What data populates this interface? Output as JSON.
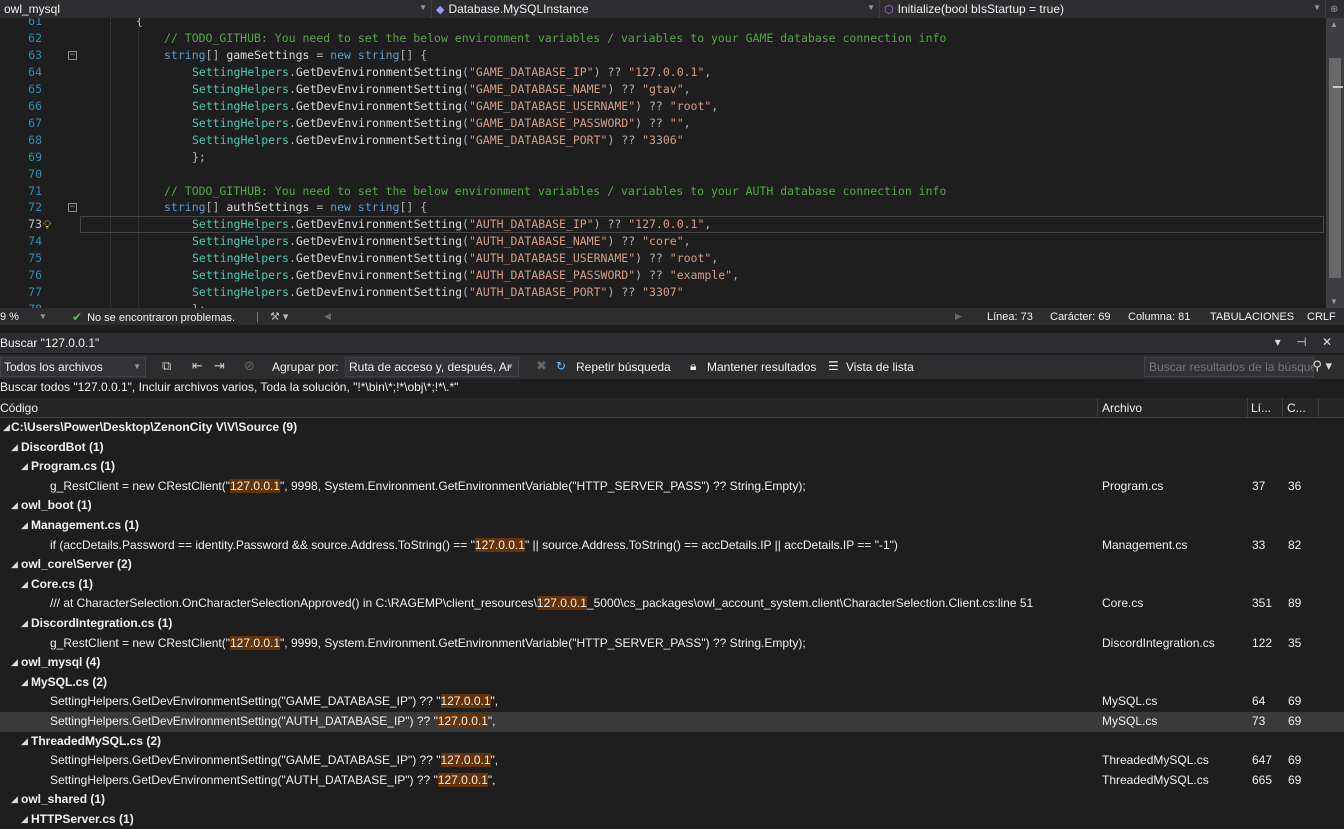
{
  "nav": {
    "project": "owl_mysql",
    "class": "Database.MySQLInstance",
    "method": "Initialize(bool bIsStartup = true)"
  },
  "editor": {
    "lines": [
      {
        "n": "61",
        "text": "{"
      },
      {
        "n": "62",
        "text": "// TODO_GITHUB: You need to set the below environment variables / variables to your GAME database connection info"
      },
      {
        "n": "63",
        "text": "string[] gameSettings = new string[] {"
      },
      {
        "n": "64",
        "text": "SettingHelpers.GetDevEnvironmentSetting(\"GAME_DATABASE_IP\") ?? \"127.0.0.1\","
      },
      {
        "n": "65",
        "text": "SettingHelpers.GetDevEnvironmentSetting(\"GAME_DATABASE_NAME\") ?? \"gtav\","
      },
      {
        "n": "66",
        "text": "SettingHelpers.GetDevEnvironmentSetting(\"GAME_DATABASE_USERNAME\") ?? \"root\","
      },
      {
        "n": "67",
        "text": "SettingHelpers.GetDevEnvironmentSetting(\"GAME_DATABASE_PASSWORD\") ?? \"\","
      },
      {
        "n": "68",
        "text": "SettingHelpers.GetDevEnvironmentSetting(\"GAME_DATABASE_PORT\") ?? \"3306\""
      },
      {
        "n": "69",
        "text": "};"
      },
      {
        "n": "70",
        "text": ""
      },
      {
        "n": "71",
        "text": "// TODO_GITHUB: You need to set the below environment variables / variables to your AUTH database connection info"
      },
      {
        "n": "72",
        "text": "string[] authSettings = new string[] {"
      },
      {
        "n": "73",
        "text": "SettingHelpers.GetDevEnvironmentSetting(\"AUTH_DATABASE_IP\") ?? \"127.0.0.1\","
      },
      {
        "n": "74",
        "text": "SettingHelpers.GetDevEnvironmentSetting(\"AUTH_DATABASE_NAME\") ?? \"core\","
      },
      {
        "n": "75",
        "text": "SettingHelpers.GetDevEnvironmentSetting(\"AUTH_DATABASE_USERNAME\") ?? \"root\","
      },
      {
        "n": "76",
        "text": "SettingHelpers.GetDevEnvironmentSetting(\"AUTH_DATABASE_PASSWORD\") ?? \"example\","
      },
      {
        "n": "77",
        "text": "SettingHelpers.GetDevEnvironmentSetting(\"AUTH_DATABASE_PORT\") ?? \"3307\""
      },
      {
        "n": "78",
        "text": "};"
      }
    ]
  },
  "status": {
    "zoom": "9 %",
    "problems": "No se encontraron problemas.",
    "line": "Línea: 73",
    "char": "Carácter: 69",
    "column": "Columna: 81",
    "tabs": "TABULACIONES",
    "eol": "CRLF"
  },
  "find": {
    "title": "Buscar \"127.0.0.1\"",
    "controls": "▾ ⊣ ✕",
    "scope": "Todos los archivos",
    "group_label": "Agrupar por:",
    "group_value": "Ruta de acceso y, después, Ar",
    "repeat": "Repetir búsqueda",
    "keep": "Mantener resultados",
    "list_view": "Vista de lista",
    "search_placeholder": "Buscar resultados de la búsqueda",
    "summary": "Buscar todos \"127.0.0.1\", Incluir archivos varios, Toda la solución, \"!*\\bin\\*;!*\\obj\\*;!*\\.*\"",
    "columns": {
      "code": "Código",
      "file": "Archivo",
      "line": "Lí...",
      "col": "C..."
    }
  },
  "results": [
    {
      "level": 0,
      "label": "C:\\Users\\Power\\Desktop\\ZenonCity V\\V\\Source (9)"
    },
    {
      "level": 1,
      "label": "DiscordBot (1)"
    },
    {
      "level": 2,
      "label": "Program.cs (1)"
    },
    {
      "level": 3,
      "pre": "g_RestClient = new CRestClient(\"",
      "match": "127.0.0.1",
      "post": "\", 9998, System.Environment.GetEnvironmentVariable(\"HTTP_SERVER_PASS\") ?? String.Empty);",
      "file": "Program.cs",
      "line": "37",
      "col": "36"
    },
    {
      "level": 1,
      "label": "owl_boot (1)"
    },
    {
      "level": 2,
      "label": "Management.cs (1)"
    },
    {
      "level": 3,
      "pre": "if (accDetails.Password == identity.Password && source.Address.ToString() == \"",
      "match": "127.0.0.1",
      "post": "\" || source.Address.ToString() == accDetails.IP || accDetails.IP == \"-1\")",
      "file": "Management.cs",
      "line": "33",
      "col": "82"
    },
    {
      "level": 1,
      "label": "owl_core\\Server (2)"
    },
    {
      "level": 2,
      "label": "Core.cs (1)"
    },
    {
      "level": 3,
      "pre": "/// at CharacterSelection.OnCharacterSelectionApproved() in C:\\RAGEMP\\client_resources\\",
      "match": "127.0.0.1",
      "post": "_5000\\cs_packages\\owl_account_system.client\\CharacterSelection.Client.cs:line 51",
      "file": "Core.cs",
      "line": "351",
      "col": "89"
    },
    {
      "level": 2,
      "label": "DiscordIntegration.cs (1)"
    },
    {
      "level": 3,
      "pre": "g_RestClient = new CRestClient(\"",
      "match": "127.0.0.1",
      "post": "\", 9999, System.Environment.GetEnvironmentVariable(\"HTTP_SERVER_PASS\") ?? String.Empty);",
      "file": "DiscordIntegration.cs",
      "line": "122",
      "col": "35"
    },
    {
      "level": 1,
      "label": "owl_mysql (4)"
    },
    {
      "level": 2,
      "label": "MySQL.cs (2)"
    },
    {
      "level": 3,
      "pre": "SettingHelpers.GetDevEnvironmentSetting(\"GAME_DATABASE_IP\") ?? \"",
      "match": "127.0.0.1",
      "post": "\",",
      "file": "MySQL.cs",
      "line": "64",
      "col": "69"
    },
    {
      "level": 3,
      "pre": "SettingHelpers.GetDevEnvironmentSetting(\"AUTH_DATABASE_IP\") ?? \"",
      "match": "127.0.0.1",
      "post": "\",",
      "file": "MySQL.cs",
      "line": "73",
      "col": "69",
      "selected": true
    },
    {
      "level": 2,
      "label": "ThreadedMySQL.cs (2)"
    },
    {
      "level": 3,
      "pre": "SettingHelpers.GetDevEnvironmentSetting(\"GAME_DATABASE_IP\") ?? \"",
      "match": "127.0.0.1",
      "post": "\",",
      "file": "ThreadedMySQL.cs",
      "line": "647",
      "col": "69"
    },
    {
      "level": 3,
      "pre": "SettingHelpers.GetDevEnvironmentSetting(\"AUTH_DATABASE_IP\") ?? \"",
      "match": "127.0.0.1",
      "post": "\",",
      "file": "ThreadedMySQL.cs",
      "line": "665",
      "col": "69"
    },
    {
      "level": 1,
      "label": "owl_shared (1)"
    },
    {
      "level": 2,
      "label": "HTTPServer.cs (1)"
    }
  ]
}
